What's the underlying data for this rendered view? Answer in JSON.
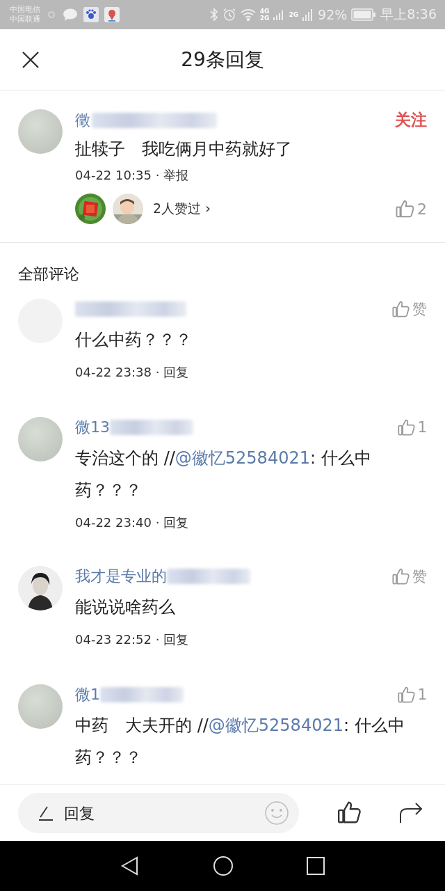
{
  "status_bar": {
    "carriers": [
      "中国电信",
      "中国联通"
    ],
    "network_labels": [
      "4G",
      "2G",
      "2G"
    ],
    "battery": "92%",
    "time": "早上8:36"
  },
  "header": {
    "title": "29条回复"
  },
  "post": {
    "author": "徵",
    "follow": "关注",
    "text": "扯犊子　我吃俩月中药就好了",
    "time": "04-22 10:35",
    "separator": "·",
    "report": "举报",
    "likes_text": "2人赞过",
    "chevron": "›",
    "like_count": "2"
  },
  "section_title": "全部评论",
  "comments": [
    {
      "avatar": {
        "kind": "blank"
      },
      "text": "什么中药？？？",
      "time": "04-22 23:38",
      "separator": "·",
      "reply": "回复",
      "like": "赞"
    },
    {
      "author": "微13",
      "avatar": {
        "kind": "gray"
      },
      "text": "专治这个的 //",
      "mention": "@徽忆52584021",
      "text_after": ": 什么中药？？？",
      "time": "04-22 23:40",
      "separator": "·",
      "reply": "回复",
      "like": "1"
    },
    {
      "author": "我才是专业的",
      "avatar": {
        "kind": "figure"
      },
      "text": "能说说啥药么",
      "time": "04-23 22:52",
      "separator": "·",
      "reply": "回复",
      "like": "赞"
    },
    {
      "author": "微1",
      "avatar": {
        "kind": "gray"
      },
      "text": "中药　大夫开的 //",
      "mention": "@徽忆52584021",
      "text_after": ": 什么中药？？？",
      "like": "1"
    }
  ],
  "bottom_bar": {
    "placeholder": "回复"
  }
}
